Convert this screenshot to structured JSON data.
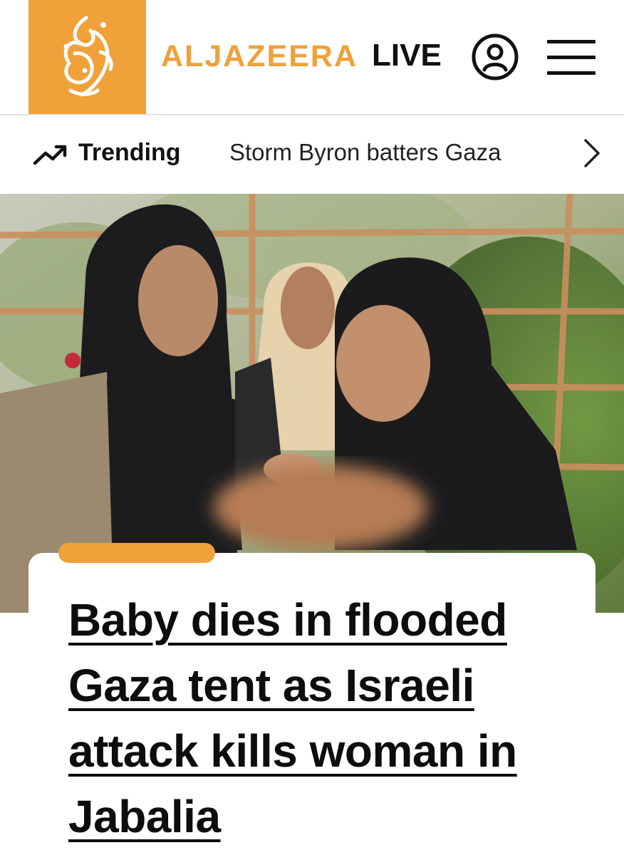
{
  "header": {
    "brand_name": "ALJAZEERA",
    "live_label": "LIVE",
    "logo_icon": "aljazeera-calligraphy-logo",
    "account_icon": "user-account-icon",
    "menu_icon": "hamburger-menu-icon",
    "brand_color": "#f0a13a"
  },
  "trending": {
    "label": "Trending",
    "icon": "trending-up-icon",
    "story": "Storm Byron batters Gaza",
    "next_icon": "chevron-right-icon"
  },
  "article": {
    "headline": "Baby dies in flooded Gaza tent as Israeli attack kills woman in Jabalia",
    "accent_color": "#f0a13a"
  }
}
